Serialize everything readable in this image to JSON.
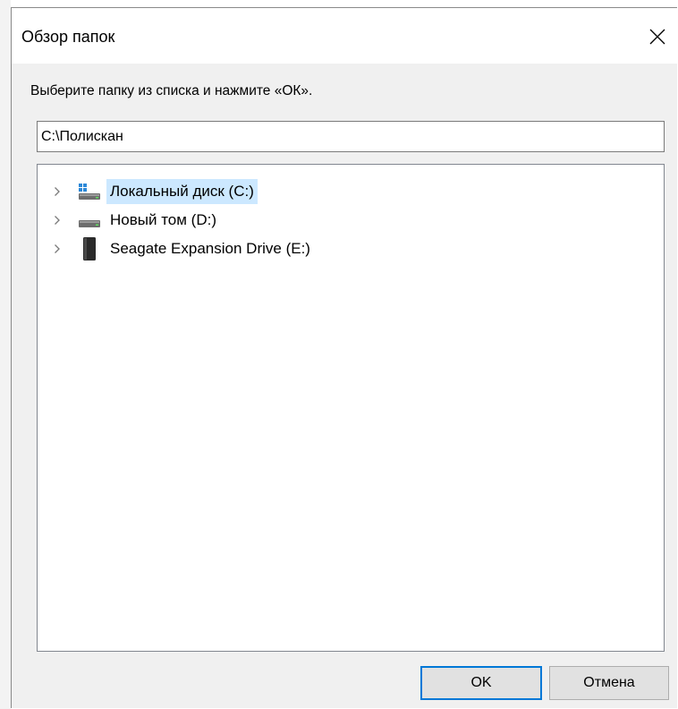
{
  "dialog": {
    "title": "Обзор папок",
    "instruction": "Выберите папку из списка и нажмите «ОК».",
    "path_value": "C:\\Полискан"
  },
  "tree": {
    "items": [
      {
        "label": "Локальный диск (C:)",
        "icon": "system-drive-icon",
        "selected": true
      },
      {
        "label": "Новый том (D:)",
        "icon": "hard-drive-icon",
        "selected": false
      },
      {
        "label": "Seagate Expansion Drive (E:)",
        "icon": "external-drive-icon",
        "selected": false
      }
    ]
  },
  "buttons": {
    "ok_label": "OK",
    "cancel_label": "Отмена"
  },
  "colors": {
    "selection": "#cce8ff",
    "accent": "#0078d7",
    "dialog_bg": "#f0f0f0"
  }
}
